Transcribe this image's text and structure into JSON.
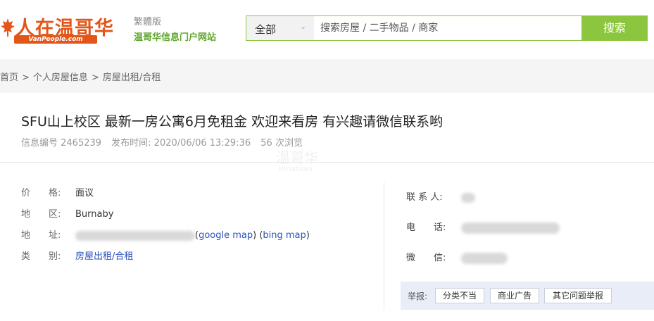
{
  "header": {
    "logo_text": "人在温哥华",
    "logo_domain": "VanPeople.com",
    "variant_link": "繁體版",
    "slogan": "温哥华信息门户网站"
  },
  "search": {
    "category": "全部",
    "placeholder": "搜索房屋 / 二手物品 / 商家",
    "button_label": "搜索"
  },
  "breadcrumb": {
    "items": [
      "首页",
      "个人房屋信息",
      "房屋出租/合租"
    ],
    "separator": ">"
  },
  "listing": {
    "title": "SFU山上校区 最新一房公寓6月免租金 欢迎来看房 有兴趣请微信联系哟",
    "info_id": "信息编号 2465239",
    "published": "发布时间: 2020/06/06 13:29:36",
    "views": "56 次浏览"
  },
  "watermark": {
    "text": "温哥华",
    "sub": "Hinablan"
  },
  "details": {
    "price_label": "价　　格:",
    "price_value": "面议",
    "area_label": "地　　区:",
    "area_value": "Burnaby",
    "address_label": "地　　址:",
    "google_map": "google map",
    "bing_map": "bing map",
    "category_label": "类　　别:",
    "category_value": "房屋出租/合租"
  },
  "contact": {
    "person_label": "联 系 人:",
    "phone_label": "电　　话:",
    "wechat_label": "微　　信:"
  },
  "report": {
    "label": "举报:",
    "buttons": [
      "分类不当",
      "商业广告",
      "其它问题举报"
    ]
  }
}
